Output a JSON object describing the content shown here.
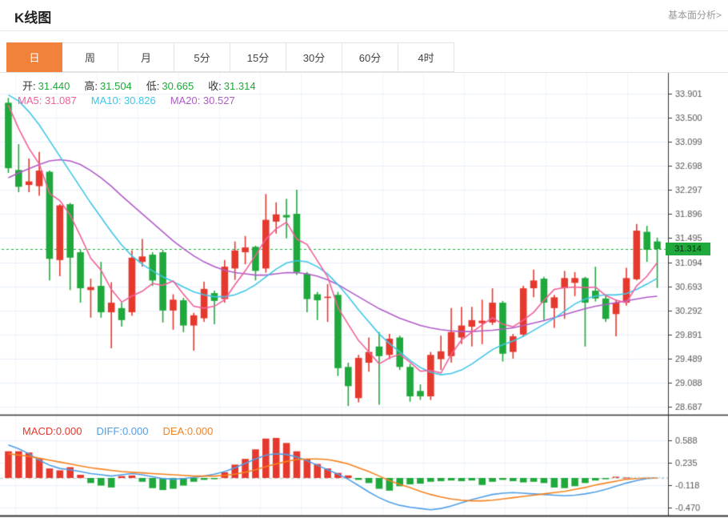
{
  "page": {
    "title": "K线图",
    "link": "基本面分析>"
  },
  "tabs": {
    "items": [
      "日",
      "周",
      "月",
      "5分",
      "15分",
      "30分",
      "60分",
      "4时"
    ],
    "active_index": 0
  },
  "ohlc": {
    "open_label": "开:",
    "open": "31.440",
    "high_label": "高:",
    "high": "31.504",
    "low_label": "低:",
    "low": "30.665",
    "close_label": "收:",
    "close": "31.314"
  },
  "ma_header": {
    "ma5_label": "MA5:",
    "ma5": "31.087",
    "ma10_label": "MA10:",
    "ma10": "30.826",
    "ma20_label": "MA20:",
    "ma20": "30.527"
  },
  "macd_header": {
    "macd_label": "MACD:",
    "macd": "0.000",
    "diff_label": "DIFF:",
    "diff": "0.000",
    "dea_label": "DEA:",
    "dea": "0.000"
  },
  "current_price_tag": "31.314",
  "colors": {
    "up": "#e5392e",
    "down": "#1fa83c",
    "ma5": "#f0609a",
    "ma10": "#3fc6e8",
    "ma20": "#b05cc8",
    "diff": "#4f9fe8",
    "dea": "#f5821e",
    "macd_text": "#e5392e",
    "accent_tab": "#f0823c",
    "grid_h": "#e9eef7",
    "grid_v": "#f1f4fa",
    "frame": "#333333",
    "axis_text": "#555555",
    "zero_dash": "#c8c8c8",
    "diff_dotted": "#a5d8ec",
    "ohlc_value": "#1fa83c",
    "tag_text": "#08300f"
  },
  "chart_data": [
    {
      "type": "candlestick",
      "title": "K线图",
      "legend": [
        "MA5",
        "MA10",
        "MA20"
      ],
      "current_price": 31.314,
      "y_ticks": [
        33.901,
        33.5,
        33.099,
        32.698,
        32.297,
        31.896,
        31.495,
        31.094,
        30.693,
        30.292,
        29.891,
        29.489,
        29.088,
        28.687
      ],
      "y_tick_labels": [
        "33.901",
        "33.500",
        "33.099",
        "32.698",
        "32.297",
        "31.896",
        "31.495",
        "31.094",
        "30.693",
        "30.292",
        "29.891",
        "29.489",
        "29.088",
        "28.687"
      ],
      "ylim": [
        28.55,
        34.05
      ],
      "candles": [
        [
          33.75,
          33.83,
          32.58,
          32.66
        ],
        [
          32.63,
          33.06,
          32.26,
          32.35
        ],
        [
          32.38,
          32.82,
          32.26,
          32.44
        ],
        [
          32.36,
          32.93,
          32.2,
          32.62
        ],
        [
          32.6,
          32.62,
          30.79,
          31.15
        ],
        [
          31.13,
          32.06,
          30.86,
          32.04
        ],
        [
          32.06,
          32.08,
          30.63,
          31.17
        ],
        [
          31.26,
          31.3,
          30.42,
          30.66
        ],
        [
          30.63,
          30.82,
          30.17,
          30.68
        ],
        [
          30.7,
          31.1,
          30.17,
          30.26
        ],
        [
          30.26,
          30.76,
          29.66,
          30.42
        ],
        [
          30.33,
          30.42,
          30.02,
          30.13
        ],
        [
          30.26,
          31.29,
          30.2,
          31.17
        ],
        [
          31.1,
          31.48,
          31.02,
          31.19
        ],
        [
          31.22,
          31.26,
          30.7,
          30.79
        ],
        [
          31.26,
          31.3,
          30.09,
          30.29
        ],
        [
          30.29,
          30.56,
          29.97,
          30.47
        ],
        [
          30.46,
          30.5,
          29.93,
          30.04
        ],
        [
          30.04,
          30.25,
          29.62,
          30.21
        ],
        [
          30.16,
          30.77,
          30.1,
          30.65
        ],
        [
          30.58,
          30.62,
          30.06,
          30.45
        ],
        [
          30.48,
          31.13,
          30.42,
          31.02
        ],
        [
          30.99,
          31.44,
          30.8,
          31.29
        ],
        [
          31.26,
          31.53,
          31.06,
          31.34
        ],
        [
          31.35,
          31.37,
          30.79,
          30.95
        ],
        [
          30.99,
          32.23,
          30.92,
          31.8
        ],
        [
          31.77,
          32.09,
          31.57,
          31.89
        ],
        [
          31.88,
          32.15,
          31.49,
          31.84
        ],
        [
          31.9,
          32.3,
          30.88,
          30.93
        ],
        [
          30.9,
          30.93,
          30.26,
          30.48
        ],
        [
          30.56,
          30.6,
          30.13,
          30.46
        ],
        [
          30.5,
          30.73,
          30.1,
          30.52
        ],
        [
          30.55,
          30.6,
          29.2,
          29.33
        ],
        [
          29.35,
          29.42,
          28.7,
          29.03
        ],
        [
          28.83,
          29.55,
          28.76,
          29.5
        ],
        [
          29.42,
          29.84,
          29.27,
          29.6
        ],
        [
          29.69,
          29.93,
          28.72,
          29.53
        ],
        [
          29.55,
          29.9,
          29.48,
          29.82
        ],
        [
          29.84,
          29.87,
          29.3,
          29.35
        ],
        [
          29.35,
          29.4,
          28.77,
          28.86
        ],
        [
          28.95,
          29.06,
          28.8,
          28.86
        ],
        [
          28.86,
          29.6,
          28.8,
          29.55
        ],
        [
          29.48,
          29.87,
          29.3,
          29.61
        ],
        [
          29.53,
          30.33,
          29.42,
          29.93
        ],
        [
          29.84,
          30.35,
          29.73,
          30.04
        ],
        [
          30.02,
          30.35,
          29.69,
          30.13
        ],
        [
          30.08,
          30.47,
          29.73,
          30.12
        ],
        [
          30.09,
          30.66,
          30.05,
          30.42
        ],
        [
          30.42,
          30.45,
          29.44,
          29.57
        ],
        [
          29.6,
          29.9,
          29.49,
          29.86
        ],
        [
          29.89,
          30.7,
          29.85,
          30.66
        ],
        [
          30.66,
          30.97,
          30.51,
          30.79
        ],
        [
          30.82,
          30.85,
          30.13,
          30.42
        ],
        [
          30.33,
          30.55,
          30.0,
          30.51
        ],
        [
          30.66,
          30.95,
          30.15,
          30.83
        ],
        [
          30.75,
          30.93,
          30.53,
          30.83
        ],
        [
          30.83,
          30.85,
          29.69,
          30.42
        ],
        [
          30.62,
          31.02,
          30.44,
          30.49
        ],
        [
          30.49,
          30.55,
          30.1,
          30.15
        ],
        [
          30.23,
          30.47,
          29.86,
          30.42
        ],
        [
          30.42,
          31.0,
          30.37,
          30.83
        ],
        [
          30.81,
          31.73,
          30.79,
          31.62
        ],
        [
          31.6,
          31.7,
          31.1,
          31.3
        ],
        [
          31.44,
          31.504,
          30.665,
          31.314
        ]
      ],
      "ma5": [
        33.71,
        33.32,
        32.99,
        32.73,
        32.24,
        32.12,
        31.88,
        31.53,
        31.16,
        30.96,
        30.64,
        30.43,
        30.53,
        30.61,
        30.74,
        30.71,
        30.78,
        30.56,
        30.36,
        30.33,
        30.36,
        30.47,
        30.72,
        30.95,
        31.21,
        31.48,
        31.65,
        31.76,
        31.48,
        31.39,
        31.12,
        30.85,
        30.34,
        30.06,
        29.79,
        29.6,
        29.4,
        29.5,
        29.56,
        29.43,
        29.28,
        29.29,
        29.25,
        29.56,
        29.8,
        29.93,
        30.05,
        30.17,
        30.06,
        30.02,
        30.13,
        30.26,
        30.46,
        30.64,
        30.67,
        30.68,
        30.67,
        30.68,
        30.54,
        30.46,
        30.42,
        30.7,
        30.86,
        31.087
      ],
      "ma10": [
        33.88,
        33.78,
        33.6,
        33.38,
        33.12,
        32.86,
        32.6,
        32.34,
        32.08,
        31.84,
        31.6,
        31.38,
        31.2,
        31.06,
        30.95,
        30.85,
        30.77,
        30.68,
        30.6,
        30.55,
        30.52,
        30.52,
        30.55,
        30.62,
        30.72,
        30.85,
        30.98,
        31.08,
        31.12,
        31.1,
        31.02,
        30.9,
        30.72,
        30.52,
        30.3,
        30.1,
        29.9,
        29.74,
        29.6,
        29.46,
        29.34,
        29.26,
        29.22,
        29.24,
        29.3,
        29.4,
        29.52,
        29.64,
        29.72,
        29.78,
        29.86,
        29.96,
        30.06,
        30.16,
        30.28,
        30.4,
        30.48,
        30.53,
        30.55,
        30.55,
        30.57,
        30.64,
        30.73,
        30.826
      ],
      "ma20": [
        32.5,
        32.58,
        32.65,
        32.72,
        32.78,
        32.8,
        32.78,
        32.72,
        32.62,
        32.5,
        32.36,
        32.2,
        32.05,
        31.9,
        31.75,
        31.6,
        31.45,
        31.32,
        31.2,
        31.1,
        31.02,
        30.96,
        30.92,
        30.9,
        30.88,
        30.88,
        30.9,
        30.92,
        30.92,
        30.9,
        30.86,
        30.8,
        30.72,
        30.62,
        30.52,
        30.42,
        30.32,
        30.24,
        30.16,
        30.1,
        30.04,
        30.0,
        29.97,
        29.95,
        29.94,
        29.94,
        29.95,
        29.96,
        29.98,
        30.0,
        30.04,
        30.08,
        30.12,
        30.17,
        30.22,
        30.27,
        30.32,
        30.36,
        30.39,
        30.42,
        30.45,
        30.48,
        30.51,
        30.527
      ]
    },
    {
      "type": "bar",
      "title": "MACD",
      "legend": [
        "MACD",
        "DIFF",
        "DEA"
      ],
      "y_ticks": [
        0.588,
        0.235,
        -0.118,
        -0.47
      ],
      "y_tick_labels": [
        "0.588",
        "0.235",
        "-0.118",
        "-0.470"
      ],
      "ylim": [
        -0.62,
        0.75
      ],
      "histogram": [
        0.42,
        0.42,
        0.4,
        0.3,
        0.15,
        0.12,
        0.17,
        0.05,
        -0.08,
        -0.12,
        -0.15,
        0.03,
        0.04,
        -0.06,
        -0.16,
        -0.19,
        -0.17,
        -0.12,
        -0.06,
        -0.03,
        -0.02,
        0.09,
        0.21,
        0.3,
        0.45,
        0.62,
        0.63,
        0.55,
        0.42,
        0.3,
        0.22,
        0.15,
        0.08,
        0.04,
        -0.03,
        -0.08,
        -0.17,
        -0.2,
        -0.13,
        -0.1,
        -0.09,
        -0.06,
        -0.05,
        -0.04,
        -0.05,
        -0.04,
        -0.11,
        -0.06,
        -0.03,
        -0.05,
        -0.07,
        -0.06,
        -0.08,
        -0.15,
        -0.16,
        -0.13,
        -0.08,
        -0.04,
        -0.02,
        0.02,
        0.01,
        0.0,
        0.0,
        0.0
      ],
      "diff": [
        0.52,
        0.46,
        0.38,
        0.28,
        0.2,
        0.15,
        0.13,
        0.1,
        0.07,
        0.05,
        0.03,
        0.05,
        0.07,
        0.05,
        0.02,
        -0.01,
        -0.02,
        -0.01,
        0.01,
        0.03,
        0.06,
        0.1,
        0.16,
        0.23,
        0.3,
        0.36,
        0.38,
        0.37,
        0.33,
        0.27,
        0.2,
        0.13,
        0.06,
        -0.02,
        -0.12,
        -0.22,
        -0.31,
        -0.38,
        -0.43,
        -0.46,
        -0.48,
        -0.5,
        -0.48,
        -0.44,
        -0.39,
        -0.34,
        -0.3,
        -0.26,
        -0.24,
        -0.23,
        -0.24,
        -0.25,
        -0.26,
        -0.27,
        -0.28,
        -0.27,
        -0.25,
        -0.22,
        -0.18,
        -0.13,
        -0.08,
        -0.04,
        -0.01,
        0.0
      ],
      "dea": [
        0.38,
        0.36,
        0.34,
        0.31,
        0.28,
        0.25,
        0.22,
        0.19,
        0.16,
        0.14,
        0.12,
        0.1,
        0.09,
        0.08,
        0.07,
        0.06,
        0.05,
        0.04,
        0.03,
        0.03,
        0.03,
        0.04,
        0.06,
        0.09,
        0.13,
        0.18,
        0.22,
        0.26,
        0.29,
        0.3,
        0.3,
        0.29,
        0.26,
        0.22,
        0.16,
        0.1,
        0.03,
        -0.04,
        -0.1,
        -0.15,
        -0.21,
        -0.26,
        -0.3,
        -0.33,
        -0.35,
        -0.36,
        -0.36,
        -0.35,
        -0.33,
        -0.31,
        -0.29,
        -0.27,
        -0.25,
        -0.23,
        -0.21,
        -0.18,
        -0.15,
        -0.11,
        -0.08,
        -0.05,
        -0.02,
        -0.01,
        0.0,
        0.0
      ]
    }
  ]
}
